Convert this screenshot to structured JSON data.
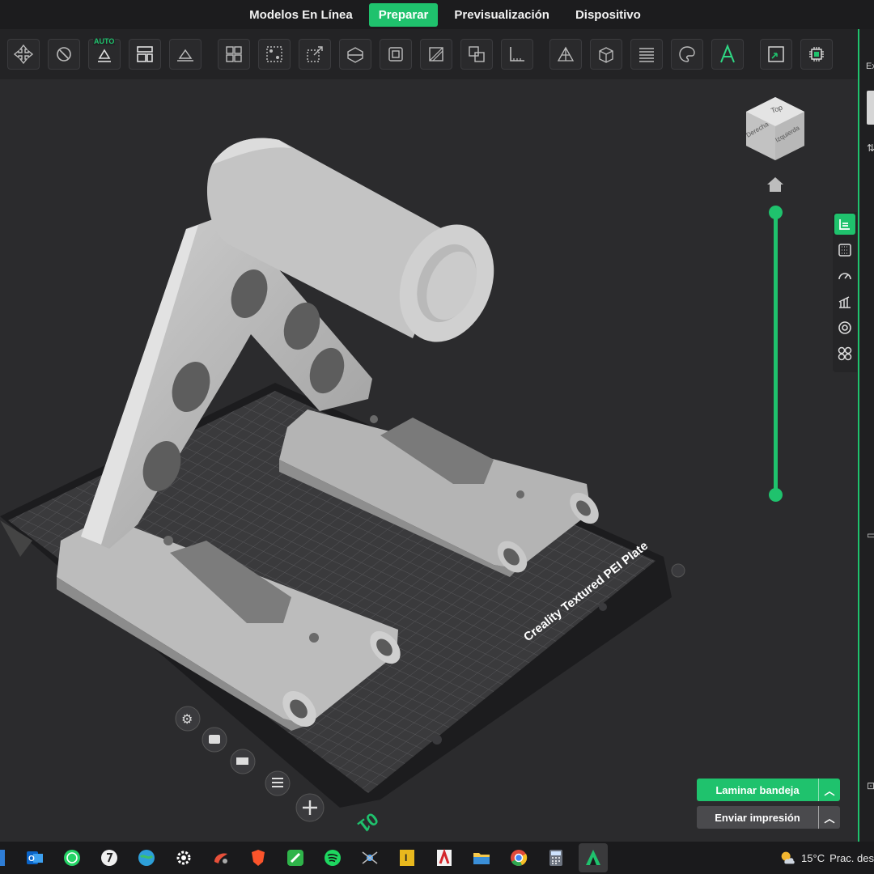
{
  "nav": {
    "tabs": [
      {
        "label": "Modelos En Línea"
      },
      {
        "label": "Preparar"
      },
      {
        "label": "Previsualización"
      },
      {
        "label": "Dispositivo"
      }
    ],
    "active_tab": "Preparar"
  },
  "toolbar": {
    "auto_badge": "AUTO",
    "icons": [
      "move-icon",
      "rotate-icon",
      "auto-orient-icon",
      "arrange-icon",
      "lay-flat-icon",
      "split-objects-icon",
      "split-parts-icon",
      "scale-icon",
      "cut-icon",
      "boolean-icon",
      "support-paint-icon",
      "seam-paint-icon",
      "measure-icon",
      "mesh-icon",
      "hollow-icon",
      "variable-layer-icon",
      "color-paint-icon",
      "text-icon",
      "assembly-icon",
      "chip-icon"
    ]
  },
  "viewport": {
    "view_cube": {
      "top_label": "Top",
      "front_label": "Derecha",
      "side_label": "Izquierda"
    },
    "plate_label": "Creality Textured PEI Plate",
    "plate_number": "01",
    "accent_color": "#1fc26d"
  },
  "right_panel": {
    "label": "Ex"
  },
  "side_tools": [
    "layers-icon",
    "infill-icon",
    "speed-icon",
    "support-icon",
    "cooling-icon",
    "others-icon"
  ],
  "actions": {
    "slice_label": "Laminar bandeja",
    "send_label": "Enviar impresión"
  },
  "taskbar": {
    "apps": [
      "outlook-icon",
      "whatsapp-icon",
      "onedrive-icon",
      "world-icon",
      "settings-icon",
      "figma-icon",
      "brave-icon",
      "pen-icon",
      "spotify-icon",
      "drone-icon",
      "inventor-icon",
      "autocad-icon",
      "file-explorer-icon",
      "chrome-icon",
      "calculator-icon",
      "creality-print-icon"
    ],
    "temperature": "15°C",
    "weather": "Prac. des"
  }
}
